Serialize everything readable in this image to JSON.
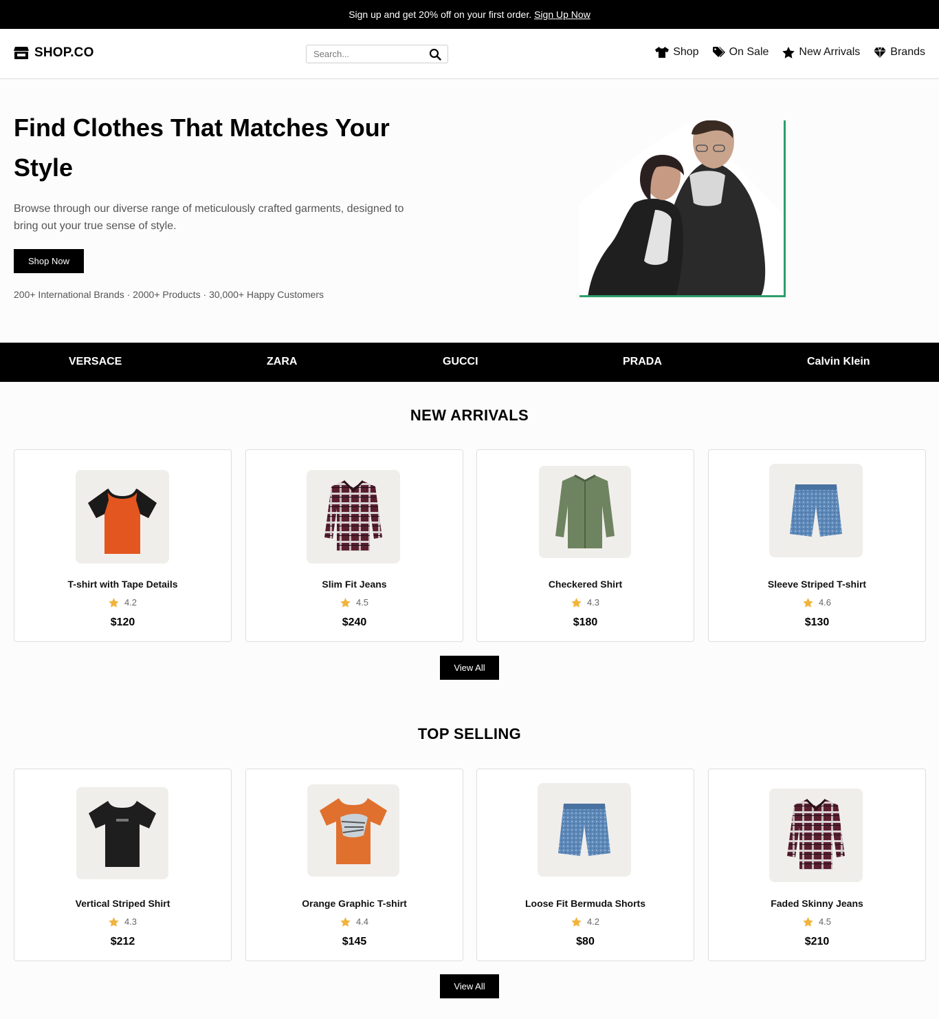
{
  "announcement": {
    "text": "Sign up and get 20% off on your first order.",
    "link": "Sign Up Now"
  },
  "header": {
    "logo": "SHOP.CO",
    "search_placeholder": "Search...",
    "nav": [
      {
        "label": "Shop",
        "icon": "tshirt-icon"
      },
      {
        "label": "On Sale",
        "icon": "tags-icon"
      },
      {
        "label": "New Arrivals",
        "icon": "star-icon"
      },
      {
        "label": "Brands",
        "icon": "gem-icon"
      }
    ]
  },
  "hero": {
    "title": "Find Clothes That Matches Your Style",
    "description": "Browse through our diverse range of meticulously crafted garments, designed to bring out your true sense of style.",
    "cta": "Shop Now",
    "stats": "200+ International Brands · 2000+ Products · 30,000+ Happy Customers",
    "accent_color": "#2e9e6b"
  },
  "brands": [
    "VERSACE",
    "ZARA",
    "GUCCI",
    "PRADA",
    "Calvin Klein"
  ],
  "new_arrivals": {
    "title": "NEW ARRIVALS",
    "view_all": "View All",
    "products": [
      {
        "name": "T-shirt with Tape Details",
        "rating": "4.2",
        "price": "$120",
        "image": "raglan-tshirt-orange-black"
      },
      {
        "name": "Slim Fit Jeans",
        "rating": "4.5",
        "price": "$240",
        "image": "plaid-shirt-maroon"
      },
      {
        "name": "Checkered Shirt",
        "rating": "4.3",
        "price": "$180",
        "image": "shirt-olive-green"
      },
      {
        "name": "Sleeve Striped T-shirt",
        "rating": "4.6",
        "price": "$130",
        "image": "denim-shorts-blue"
      }
    ]
  },
  "top_selling": {
    "title": "TOP SELLING",
    "view_all": "View All",
    "products": [
      {
        "name": "Vertical Striped Shirt",
        "rating": "4.3",
        "price": "$212",
        "image": "tshirt-black"
      },
      {
        "name": "Orange Graphic T-shirt",
        "rating": "4.4",
        "price": "$145",
        "image": "graphic-tshirt-orange"
      },
      {
        "name": "Loose Fit Bermuda Shorts",
        "rating": "4.2",
        "price": "$80",
        "image": "denim-shorts-blue"
      },
      {
        "name": "Faded Skinny Jeans",
        "rating": "4.5",
        "price": "$210",
        "image": "plaid-shirt-maroon"
      }
    ]
  },
  "colors": {
    "star": "#f0b43c",
    "dark": "#000000"
  }
}
